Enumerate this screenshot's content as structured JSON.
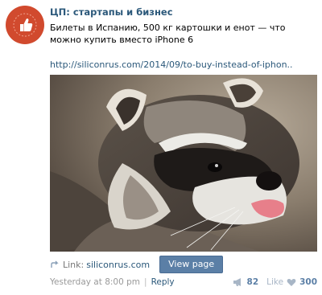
{
  "post": {
    "group_name": "ЦП: стартапы и бизнес",
    "text": "Билеты в Испанию, 500 кг картошки и енот — что можно купить вместо iPhone 6",
    "link": "http://siliconrus.com/2014/09/to-buy-instead-of-iphon..",
    "avatar_icon": "thumbs-up-icon",
    "avatar_color": "#d14a2e",
    "photo_subject": "raccoon"
  },
  "attachment": {
    "link_label": "Link:",
    "domain": "siliconrus.com",
    "view_button": "View page"
  },
  "footer": {
    "timestamp": "Yesterday at 8:00 pm",
    "separator": "|",
    "reply": "Reply",
    "reposts_count": "82",
    "like_label": "Like",
    "likes_count": "300"
  },
  "colors": {
    "link_blue": "#2b587a",
    "button_blue": "#5b7fa6"
  }
}
